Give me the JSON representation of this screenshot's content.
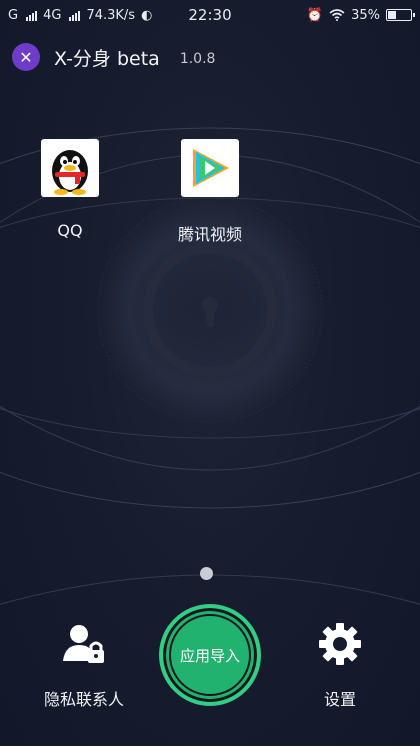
{
  "status_bar": {
    "carrier_1": "G",
    "carrier_2": "4G",
    "net_speed": "74.3K/s",
    "time": "22:30",
    "battery_percent": "35%",
    "battery_level": 0.35
  },
  "header": {
    "logo_glyph": "✕",
    "title": "X-分身 beta",
    "version": "1.0.8"
  },
  "apps": [
    {
      "label": "QQ",
      "icon": "qq-penguin-icon"
    },
    {
      "label": "腾讯视频",
      "icon": "tencent-video-icon"
    }
  ],
  "bottom_bar": {
    "privacy_contacts_label": "隐私联系人",
    "import_label": "应用导入",
    "settings_label": "设置"
  },
  "colors": {
    "background": "#151a2c",
    "accent_green": "#21b26f",
    "logo_purple": "#6e3cc8"
  }
}
